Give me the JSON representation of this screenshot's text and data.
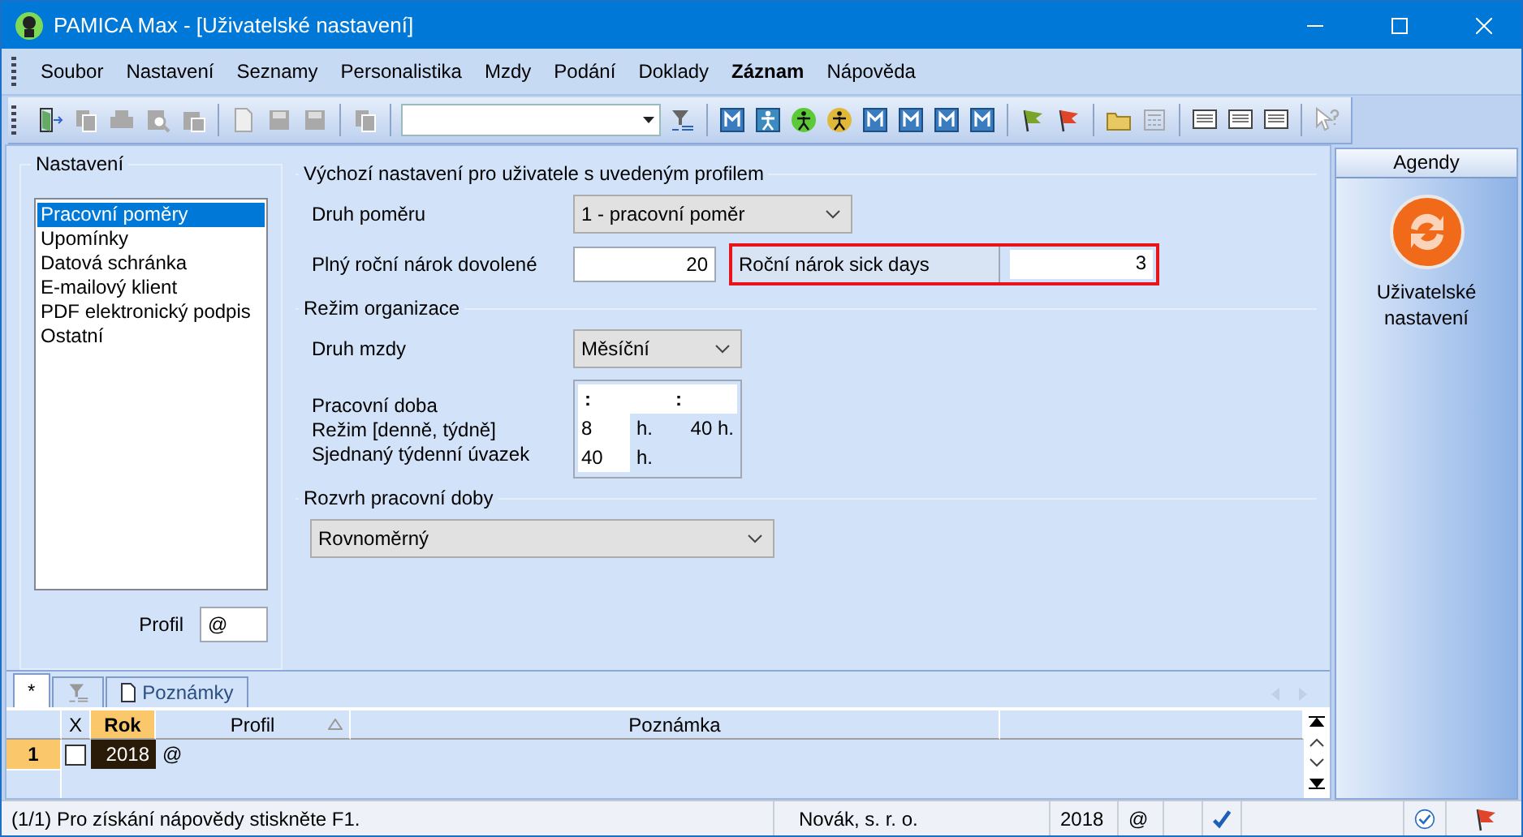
{
  "window": {
    "title": "PAMICA Max - [Uživatelské nastavení]"
  },
  "menu": [
    {
      "label": "Soubor",
      "active": false
    },
    {
      "label": "Nastavení",
      "active": false
    },
    {
      "label": "Seznamy",
      "active": false
    },
    {
      "label": "Personalistika",
      "active": false
    },
    {
      "label": "Mzdy",
      "active": false
    },
    {
      "label": "Podání",
      "active": false
    },
    {
      "label": "Doklady",
      "active": false
    },
    {
      "label": "Záznam",
      "active": true
    },
    {
      "label": "Nápověda",
      "active": false
    }
  ],
  "toolbar": [
    {
      "kind": "exit",
      "disabled": false
    },
    {
      "kind": "copy",
      "disabled": true
    },
    {
      "kind": "print",
      "disabled": true
    },
    {
      "kind": "preview",
      "disabled": true
    },
    {
      "kind": "paste",
      "disabled": true
    },
    {
      "kind": "separator"
    },
    {
      "kind": "page",
      "disabled": true
    },
    {
      "kind": "save",
      "disabled": true
    },
    {
      "kind": "save",
      "disabled": true
    },
    {
      "kind": "separator"
    },
    {
      "kind": "copy",
      "disabled": true
    },
    {
      "kind": "separator"
    },
    {
      "kind": "combo"
    },
    {
      "kind": "filter",
      "disabled": false
    },
    {
      "kind": "separator"
    },
    {
      "kind": "m-square",
      "disabled": false
    },
    {
      "kind": "person-square",
      "disabled": false
    },
    {
      "kind": "person-circle",
      "disabled": false,
      "color": "#5cc936"
    },
    {
      "kind": "person-circle",
      "disabled": false,
      "color": "#e0b83a"
    },
    {
      "kind": "m-square",
      "disabled": false
    },
    {
      "kind": "m-square",
      "disabled": false
    },
    {
      "kind": "m-square",
      "disabled": false
    },
    {
      "kind": "m-square",
      "disabled": false
    },
    {
      "kind": "separator"
    },
    {
      "kind": "flag",
      "disabled": false,
      "color": "#7aa52a"
    },
    {
      "kind": "flag",
      "disabled": false,
      "color": "#e0452a"
    },
    {
      "kind": "separator"
    },
    {
      "kind": "folder",
      "disabled": false
    },
    {
      "kind": "calculator",
      "disabled": true
    },
    {
      "kind": "separator"
    },
    {
      "kind": "note",
      "disabled": false
    },
    {
      "kind": "note",
      "disabled": false
    },
    {
      "kind": "note",
      "disabled": false
    },
    {
      "kind": "separator"
    },
    {
      "kind": "help",
      "disabled": true
    }
  ],
  "settings_panel": {
    "title": "Nastavení",
    "items": [
      {
        "label": "Pracovní poměry",
        "selected": true
      },
      {
        "label": "Upomínky",
        "selected": false
      },
      {
        "label": "Datová schránka",
        "selected": false
      },
      {
        "label": "E-mailový klient",
        "selected": false
      },
      {
        "label": "PDF elektronický podpis",
        "selected": false
      },
      {
        "label": "Ostatní",
        "selected": false
      }
    ],
    "profile_label": "Profil",
    "profile_value": "@"
  },
  "defaults": {
    "title": "Výchozí nastavení pro uživatele s uvedeným profilem",
    "relation_label": "Druh poměru",
    "relation_value": "1 - pracovní poměr",
    "vacation_label": "Plný roční nárok dovolené",
    "vacation_value": "20",
    "sick_days": {
      "label": "Roční nárok sick days",
      "value": "3",
      "highlighted": true
    },
    "organization_title": "Režim organizace",
    "wage_label": "Druh mzdy",
    "wage_value": "Měsíční",
    "hours": {
      "label": "Pracovní doba",
      "mode_label": "Režim [denně, týdně]",
      "weekly_label": "Sjednaný týdenní úvazek",
      "time_from": ":",
      "time_to": ":",
      "daily": "8",
      "daily_unit": "h.",
      "weekly_mode": "40 h.",
      "weekly": "40",
      "weekly_unit": "h."
    },
    "schedule_title": "Rozvrh pracovní doby",
    "schedule_value": "Rovnoměrný"
  },
  "agendas": {
    "title": "Agendy",
    "item": "Uživatelské nastavení"
  },
  "records": {
    "tabs": [
      {
        "kind": "star",
        "label": "*",
        "selected": true
      },
      {
        "kind": "filter",
        "selected": false
      },
      {
        "kind": "notes",
        "label": "Poznámky",
        "selected": false
      }
    ],
    "columns": [
      {
        "label": "X",
        "selected": false,
        "sorted": false
      },
      {
        "label": "Rok",
        "selected": true,
        "sorted": false
      },
      {
        "label": "Profil",
        "selected": false,
        "sorted": true
      },
      {
        "label": "Poznámka",
        "selected": false,
        "sorted": false
      }
    ],
    "rows": [
      {
        "number": "1",
        "checked": false,
        "year": "2018",
        "profile": "@",
        "selected": true
      }
    ]
  },
  "status_bar": {
    "hint": "(1/1) Pro získání nápovědy stiskněte F1.",
    "company": "Novák, s. r. o.",
    "year": "2018",
    "profile": "@"
  }
}
